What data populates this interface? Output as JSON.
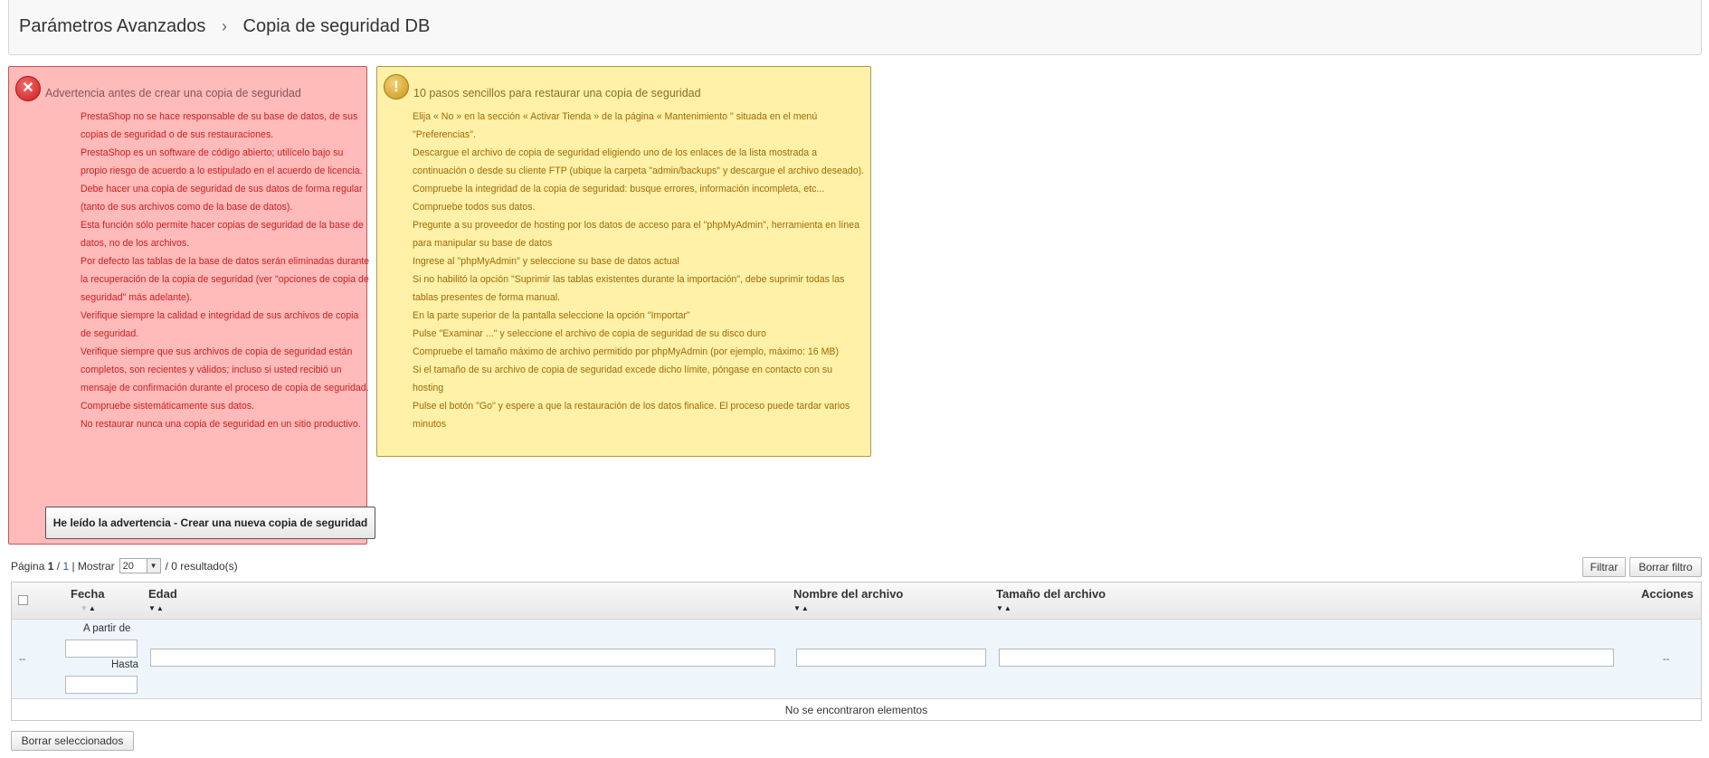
{
  "breadcrumb": {
    "parent": "Parámetros Avanzados",
    "separator": "›",
    "current": "Copia de seguridad DB"
  },
  "warning": {
    "icon": "error-x-icon",
    "title": "Advertencia antes de crear una copia de seguridad",
    "items": [
      "PrestaShop no se hace responsable de su base de datos, de sus copias de seguridad o de sus restauraciones.",
      "PrestaShop es un software de código abierto; utilícelo bajo su propio riesgo de acuerdo a lo estipulado en el acuerdo de licencia.",
      "Debe hacer una copia de seguridad de sus datos de forma regular (tanto de sus archivos como de la base de datos).",
      "Esta función sólo permite hacer copias de seguridad de la base de datos, no de los archivos.",
      "Por defecto las tablas de la base de datos serán eliminadas durante la recuperación de la copia de seguridad (ver \"opciones de copia de seguridad\" más adelante).",
      "Verifique siempre la calidad e integridad de sus archivos de copia de seguridad.",
      "Verifique siempre que sus archivos de copia de seguridad están completos, son recientes y válidos; incluso si usted recibió un mensaje de confirmación durante el proceso de copia de seguridad.",
      "Compruebe sistemáticamente sus datos.",
      "No restaurar nunca una copia de seguridad en un sitio productivo."
    ],
    "button": "He leído la advertencia - Crear una nueva copia de seguridad"
  },
  "info": {
    "icon": "exclamation-icon",
    "title": "10 pasos sencillos para restaurar una copia de seguridad",
    "items": [
      "Elija « No » en la sección « Activar Tienda » de la página « Mantenimiento \" situada en el menú \"Preferencias\".",
      "Descargue el archivo de copia de seguridad eligiendo uno de los enlaces de la lista mostrada a continuación o desde su cliente FTP (ubique la carpeta \"admin/backups\" y descargue el archivo deseado).",
      "Compruebe la integridad de la copia de seguridad: busque errores, información incompleta, etc...",
      "Compruebe todos sus datos.",
      "Pregunte a su proveedor de hosting por los datos de acceso para el \"phpMyAdmin\", herramienta en línea para manipular su base de datos",
      "Ingrese al \"phpMyAdmin\" y seleccione su base de datos actual",
      "Si no habilitó la opción \"Suprimir las tablas existentes durante la importación\", debe suprimir todas las tablas presentes de forma manual.",
      "En la parte superior de la pantalla seleccione la opción \"Importar\"",
      "Pulse \"Examinar ...\" y seleccione el archivo de copia de seguridad de su disco duro",
      "Compruebe el tamaño máximo de archivo permitido por phpMyAdmin (por ejemplo, máximo: 16 MB)",
      "Si el tamaño de su archivo de copia de seguridad excede dicho límite, póngase en contacto con su hosting",
      "Pulse el botón \"Go\" y espere a que la restauración de los datos finalice. El proceso puede tardar varios minutos"
    ]
  },
  "pagination": {
    "page_label": "Página",
    "current_page": "1",
    "slash": "/",
    "total_pages": "1",
    "show_label": "| Mostrar",
    "per_page": "20",
    "results": "/ 0 resultado(s)"
  },
  "buttons": {
    "filter": "Filtrar",
    "reset_filter": "Borrar filtro",
    "delete_selected": "Borrar seleccionados"
  },
  "table": {
    "columns": {
      "date": "Fecha",
      "age": "Edad",
      "filename": "Nombre del archivo",
      "filesize": "Tamaño del archivo",
      "actions": "Acciones"
    },
    "filters": {
      "from_label": "A partir de",
      "to_label": "Hasta",
      "dash_left": "--",
      "dash_right": "--"
    },
    "empty_message": "No se encontraron elementos"
  },
  "colors": {
    "warning_bg": "#ffbaba",
    "warning_text": "#cc1f1f",
    "info_bg": "#fff1a8",
    "info_text": "#9f6a05"
  }
}
